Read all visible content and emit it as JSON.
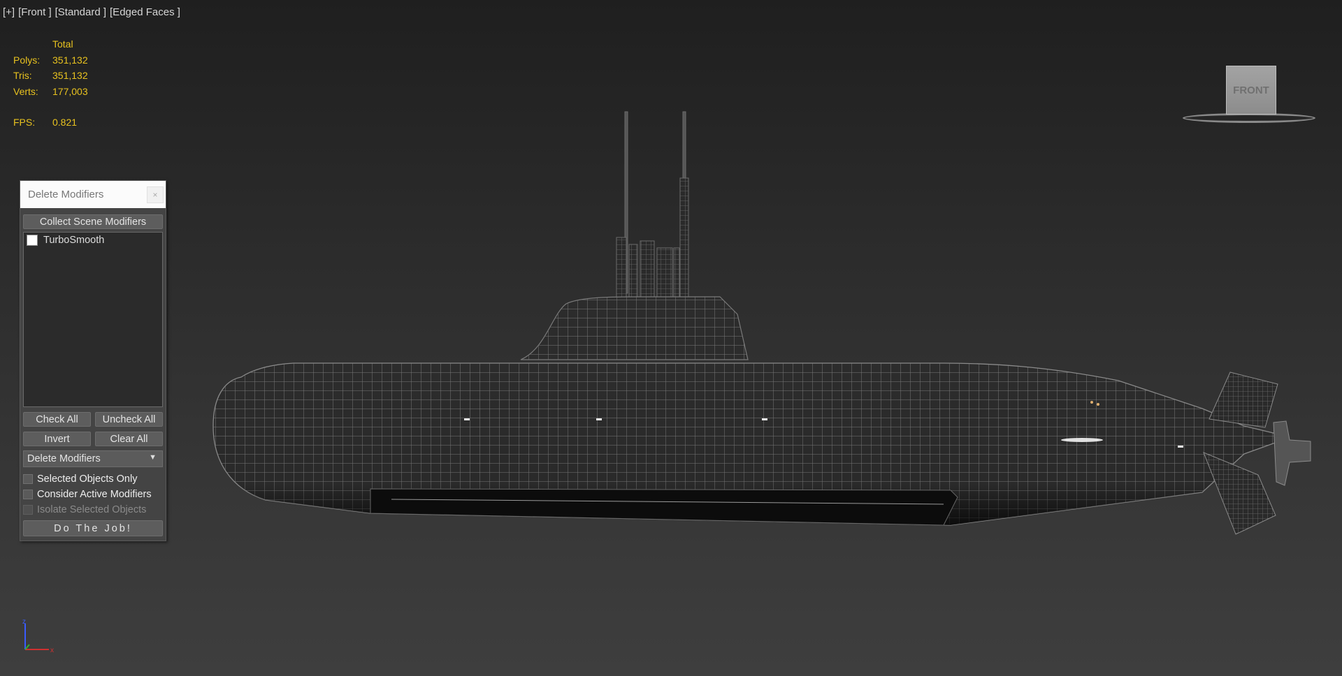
{
  "viewport": {
    "labels": [
      "[+]",
      "[Front ]",
      "[Standard ]",
      "[Edged Faces ]"
    ]
  },
  "stats": {
    "header": "Total",
    "polys_label": "Polys:",
    "polys": "351,132",
    "tris_label": "Tris:",
    "tris": "351,132",
    "verts_label": "Verts:",
    "verts": "177,003",
    "fps_label": "FPS:",
    "fps": "0.821"
  },
  "viewcube": {
    "face_label": "FRONT"
  },
  "panel": {
    "title": "Delete Modifiers",
    "close_glyph": "×",
    "collect_label": "Collect Scene Modifiers",
    "list_items": [
      "TurboSmooth"
    ],
    "check_all": "Check All",
    "uncheck_all": "Uncheck All",
    "invert": "Invert",
    "clear_all": "Clear All",
    "mode_selected": "Delete Modifiers",
    "selected_only": "Selected Objects Only",
    "consider_active": "Consider Active Modifiers",
    "isolate_selected": "Isolate Selected Objects",
    "do_job": "Do The Job!"
  },
  "axis": {
    "z": "z",
    "x": "x"
  },
  "colors": {
    "stats": "#e8c21f",
    "background": "#2b2b2b",
    "panel": "#444444"
  }
}
